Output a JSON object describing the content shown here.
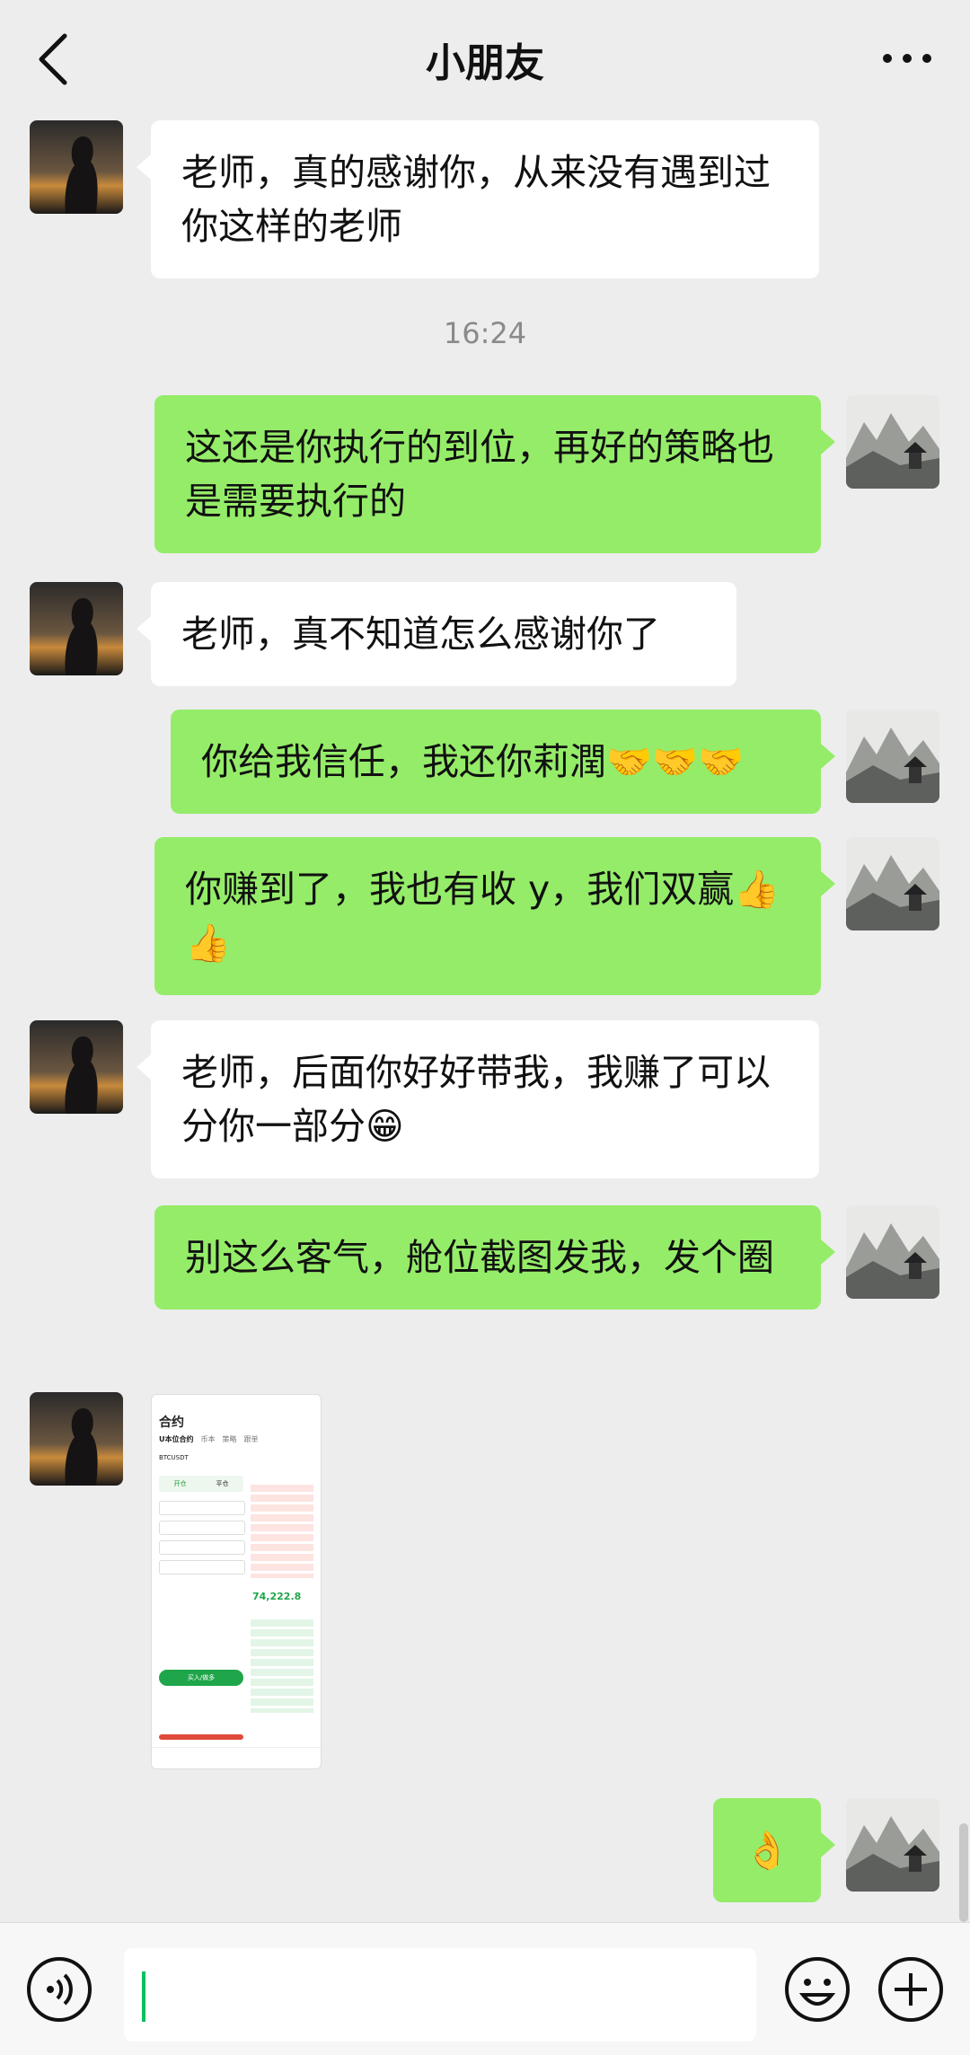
{
  "header": {
    "title": "小朋友"
  },
  "time_divider": "16:24",
  "messages": [
    {
      "text": "老师，真的感谢你，从来没有遇到过你这样的老师"
    },
    {
      "text": "这还是你执行的到位，再好的策略也是需要执行的"
    },
    {
      "text": "老师，真不知道怎么感谢你了"
    },
    {
      "text": "你给我信任，我还你莉潤🤝🤝🤝"
    },
    {
      "text": "你赚到了，我也有收 y，我们双赢👍👍"
    },
    {
      "text": "老师，后面你好好带我，我赚了可以分你一部分😁"
    },
    {
      "text": "别这么客气，舱位截图发我，发个圈"
    },
    {
      "text": "👌"
    }
  ],
  "screenshot": {
    "title": "合约",
    "tabs": [
      "U本位合约",
      "币本",
      "策略",
      "跟单"
    ],
    "pair": "BTCUSDT",
    "price": "74,222.8",
    "buy_label": "买入/做多",
    "open_label": "开仓",
    "close_label": "平仓"
  },
  "colors": {
    "bg": "#ededed",
    "mine": "#95ec69",
    "theirs": "#ffffff",
    "accent": "#07c160"
  }
}
